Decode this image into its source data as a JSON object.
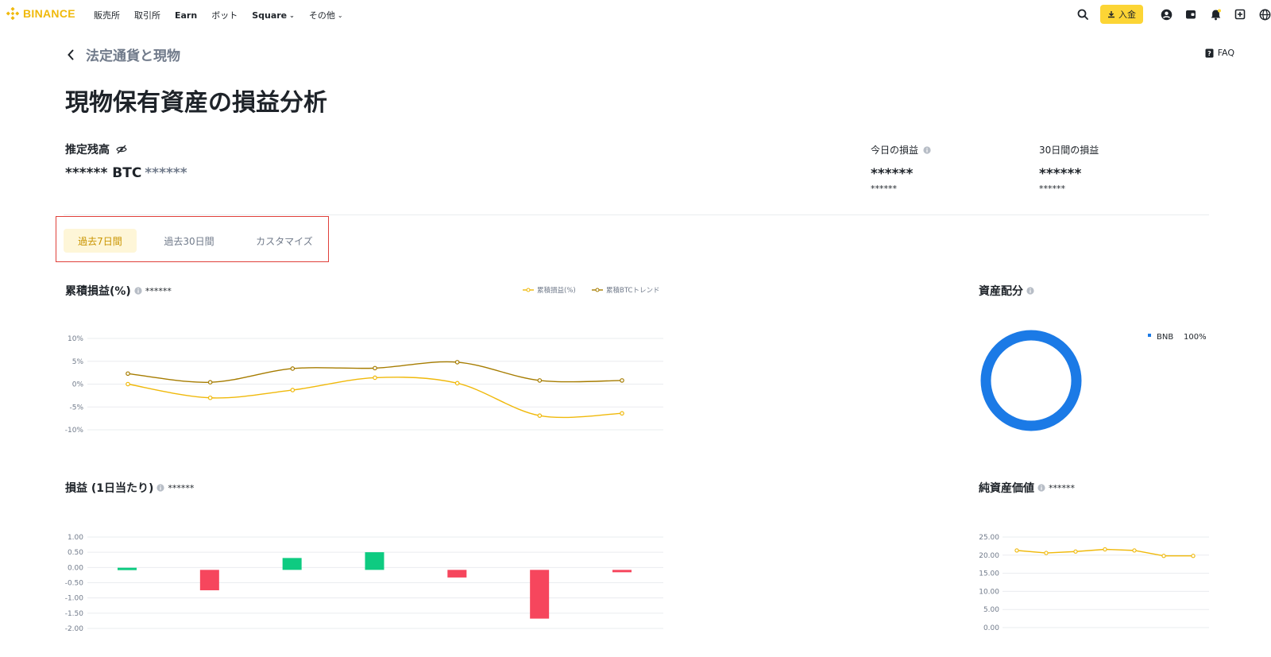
{
  "nav": {
    "brand": "BINANCE",
    "items": [
      {
        "label": "販売所",
        "bold": false,
        "chevron": false
      },
      {
        "label": "取引所",
        "bold": false,
        "chevron": false
      },
      {
        "label": "Earn",
        "bold": true,
        "chevron": false
      },
      {
        "label": "ボット",
        "bold": false,
        "chevron": false
      },
      {
        "label": "Square",
        "bold": true,
        "chevron": true
      },
      {
        "label": "その他",
        "bold": false,
        "chevron": true
      }
    ],
    "deposit_label": "入金",
    "icons": [
      "search-icon",
      "user-icon",
      "wallet-icon",
      "bell-icon",
      "download-app-icon",
      "globe-icon"
    ],
    "accent": "#fcd535"
  },
  "header": {
    "back_title": "法定通貨と現物",
    "faq": "FAQ",
    "page_title": "現物保有資産の損益分析"
  },
  "balance": {
    "label": "推定残高",
    "value": "****** BTC",
    "sub": "******",
    "today_label": "今日の損益",
    "today_value": "******",
    "today_sub": "******",
    "month_label": "30日間の損益",
    "month_value": "******",
    "month_sub": "******"
  },
  "tabs": [
    {
      "label": "過去7日間",
      "active": true
    },
    {
      "label": "過去30日間",
      "active": false
    },
    {
      "label": "カスタマイズ",
      "active": false
    }
  ],
  "sections": {
    "cumulative_title": "累積損益(%)",
    "cumulative_mask": "******",
    "allocation_title": "資産配分",
    "daily_title": "損益 (1日当たり)",
    "daily_mask": "******",
    "netvalue_title": "純資産価値",
    "netvalue_mask": "******"
  },
  "chart_data": [
    {
      "type": "line",
      "legend": [
        "累積損益(%)",
        "累積BTCトレンド"
      ],
      "legend_position": "top-right",
      "yticks": [
        "10%",
        "5%",
        "0%",
        "-5%",
        "-10%"
      ],
      "ylim": [
        -10,
        10
      ],
      "series": [
        {
          "name": "累積損益(%)",
          "color": "#f0b90b",
          "values": [
            0,
            -3,
            -1.3,
            1.4,
            0.2,
            -6.9,
            -6.4
          ]
        },
        {
          "name": "累積BTCトレンド",
          "color": "#a67c00",
          "values": [
            2.3,
            0.4,
            3.4,
            3.5,
            4.8,
            0.8,
            0.8
          ]
        }
      ],
      "grid": true
    },
    {
      "type": "pie",
      "slices": [
        {
          "label": "BNB",
          "value": 100,
          "display": "100%",
          "color": "#1b7ae6"
        }
      ],
      "legend_position": "top-right"
    },
    {
      "type": "bar",
      "yticks": [
        "1.00",
        "0.50",
        "0.00",
        "-0.50",
        "-1.00",
        "-1.50",
        "-2.00"
      ],
      "ylim": [
        -2,
        1
      ],
      "values": [
        0.07,
        -0.67,
        0.39,
        0.58,
        -0.25,
        -1.6,
        -0.07
      ],
      "positive_color": "#0ecb81",
      "negative_color": "#f6465d",
      "grid": true
    },
    {
      "type": "line",
      "yticks": [
        "25.00",
        "20.00",
        "15.00",
        "10.00",
        "5.00",
        "0.00"
      ],
      "ylim": [
        0,
        25
      ],
      "values": [
        21.3,
        20.6,
        21.0,
        21.6,
        21.3,
        19.8,
        19.8
      ],
      "color": "#f0b90b",
      "grid": true
    }
  ]
}
